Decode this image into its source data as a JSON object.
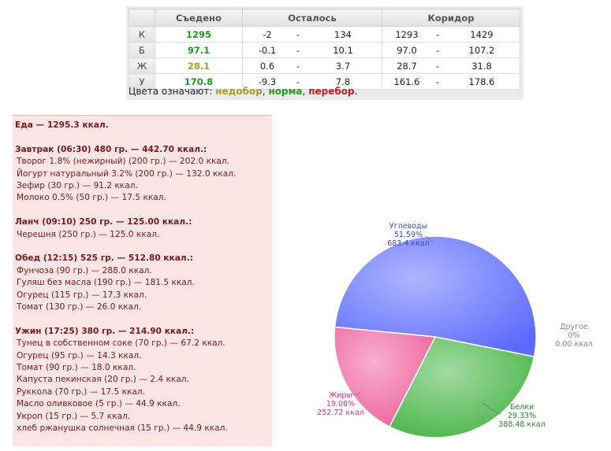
{
  "table": {
    "headers": {
      "eaten": "Съедено",
      "left": "Осталось",
      "corridor": "Коридор"
    },
    "rows": [
      {
        "label": "К",
        "eaten": "1295",
        "eaten_color": "#1e9e1e",
        "left_min": "-2",
        "left_max": "134",
        "cor_min": "1293",
        "cor_max": "1429"
      },
      {
        "label": "Б",
        "eaten": "97.1",
        "eaten_color": "#1e9e1e",
        "left_min": "-0.1",
        "left_max": "10.1",
        "cor_min": "97.0",
        "cor_max": "107.2"
      },
      {
        "label": "Ж",
        "eaten": "28.1",
        "eaten_color": "#a8a020",
        "left_min": "0.6",
        "left_max": "3.7",
        "cor_min": "28.7",
        "cor_max": "31.8"
      },
      {
        "label": "У",
        "eaten": "170.8",
        "eaten_color": "#1e9e1e",
        "left_min": "-9.3",
        "left_max": "7.8",
        "cor_min": "161.6",
        "cor_max": "178.6"
      }
    ],
    "dash": "-",
    "legend": {
      "prefix": "Цвета означают:",
      "under": "недобор",
      "under_color": "#a8a020",
      "sep1": ",",
      "norm": "норма",
      "norm_color": "#1e9e1e",
      "sep2": ",",
      "over": "перебор",
      "over_color": "#c82020",
      "suffix": "."
    }
  },
  "foodlog": {
    "total": "Еда — 1295.3 ккал.",
    "meals": [
      {
        "title": "Завтрак (06:30) 480 гр. — 442.70 ккал.:",
        "items": [
          "Творог 1.8% (нежирный) (200 гр.) — 202.0 ккал.",
          "Йогурт натуральный 3.2% (200 гр.) — 132.0 ккал.",
          "Зефир (30 гр.) — 91.2 ккал.",
          "Молоко 0.5% (50 гр.) — 17.5 ккал."
        ]
      },
      {
        "title": "Ланч (09:10) 250 гр. — 125.00 ккал.:",
        "items": [
          "Черешня (250 гр.) — 125.0 ккал."
        ]
      },
      {
        "title": "Обед (12:15) 525 гр. — 512.80 ккал.:",
        "items": [
          "Фунчоза (90 гр.) — 288.0 ккал.",
          "Гуляш без масла (190 гр.) — 181.5 ккал.",
          "Огурец (115 гр.) — 17.3 ккал.",
          "Томат (130 гр.) — 26.0 ккал."
        ]
      },
      {
        "title": "Ужин (17:25) 380 гр. — 214.90 ккал.:",
        "items": [
          "Тунец в собственном соке (70 гр.) — 67.2 ккал.",
          "Огурец (95 гр.) — 14.3 ккал.",
          "Томат (90 гр.) — 18.0 ккал.",
          "Капуста пекинская (20 гр.) — 2.4 ккал.",
          "Руккола (70 гр.) — 17.5 ккал.",
          "Масло оливковое (5 гр.) — 44.9 ккал.",
          "Укроп (15 гр.) — 5.7 ккал.",
          "хлеб ржанушка солнечная (15 гр.) — 44.9 ккал."
        ]
      }
    ]
  },
  "chart_data": {
    "type": "pie",
    "slices": [
      {
        "name": "Углеводы",
        "percent": 51.59,
        "percent_label": "51.59%",
        "value_label": "683.4 ккал",
        "color": "#5b6bff"
      },
      {
        "name": "Белки",
        "percent": 29.33,
        "percent_label": "29.33%",
        "value_label": "388.48 ккал",
        "color": "#45b545"
      },
      {
        "name": "Жиры",
        "percent": 19.08,
        "percent_label": "19.08%",
        "value_label": "252.72 ккал",
        "color": "#ee5f9a"
      },
      {
        "name": "Другое",
        "percent": 0,
        "percent_label": "0%",
        "value_label": "0.00 ккал",
        "color": "#888888"
      }
    ]
  }
}
